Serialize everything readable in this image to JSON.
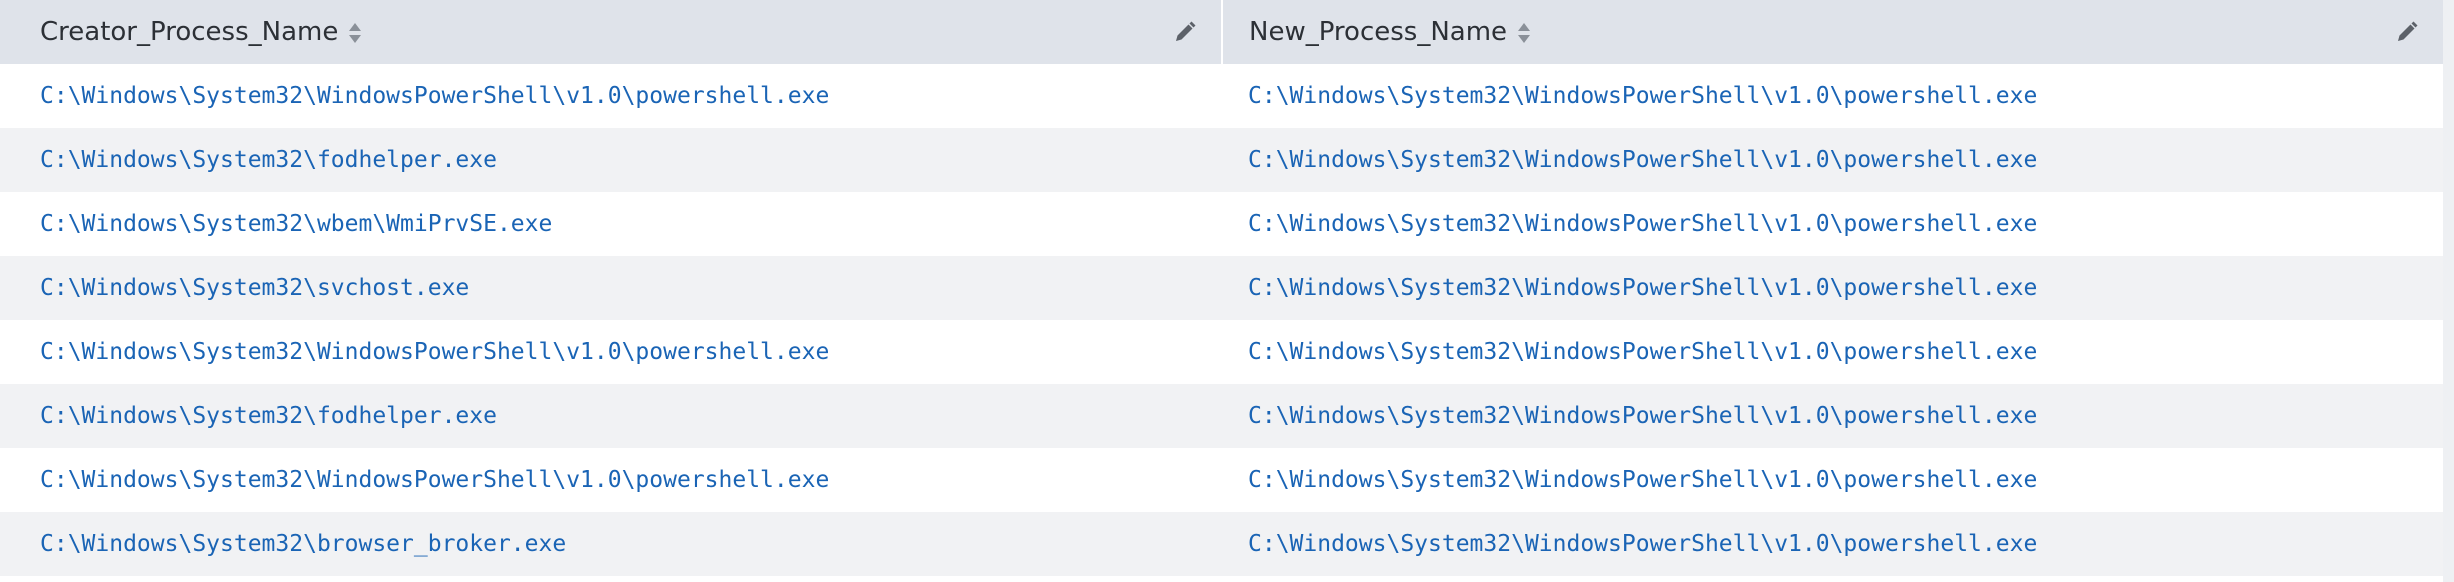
{
  "columns": [
    {
      "label": "Creator_Process_Name"
    },
    {
      "label": "New_Process_Name"
    }
  ],
  "rows": [
    {
      "creator": "C:\\Windows\\System32\\WindowsPowerShell\\v1.0\\powershell.exe",
      "new": "C:\\Windows\\System32\\WindowsPowerShell\\v1.0\\powershell.exe"
    },
    {
      "creator": "C:\\Windows\\System32\\fodhelper.exe",
      "new": "C:\\Windows\\System32\\WindowsPowerShell\\v1.0\\powershell.exe"
    },
    {
      "creator": "C:\\Windows\\System32\\wbem\\WmiPrvSE.exe",
      "new": "C:\\Windows\\System32\\WindowsPowerShell\\v1.0\\powershell.exe"
    },
    {
      "creator": "C:\\Windows\\System32\\svchost.exe",
      "new": "C:\\Windows\\System32\\WindowsPowerShell\\v1.0\\powershell.exe"
    },
    {
      "creator": "C:\\Windows\\System32\\WindowsPowerShell\\v1.0\\powershell.exe",
      "new": "C:\\Windows\\System32\\WindowsPowerShell\\v1.0\\powershell.exe"
    },
    {
      "creator": "C:\\Windows\\System32\\fodhelper.exe",
      "new": "C:\\Windows\\System32\\WindowsPowerShell\\v1.0\\powershell.exe"
    },
    {
      "creator": "C:\\Windows\\System32\\WindowsPowerShell\\v1.0\\powershell.exe",
      "new": "C:\\Windows\\System32\\WindowsPowerShell\\v1.0\\powershell.exe"
    },
    {
      "creator": "C:\\Windows\\System32\\browser_broker.exe",
      "new": "C:\\Windows\\System32\\WindowsPowerShell\\v1.0\\powershell.exe"
    }
  ],
  "icons": {
    "sort": "sort-icon",
    "edit": "pencil-icon"
  },
  "colors": {
    "header_bg": "#dfe3ea",
    "row_alt_bg": "#f1f2f4",
    "link": "#1a64b5",
    "header_text": "#2c3036"
  }
}
